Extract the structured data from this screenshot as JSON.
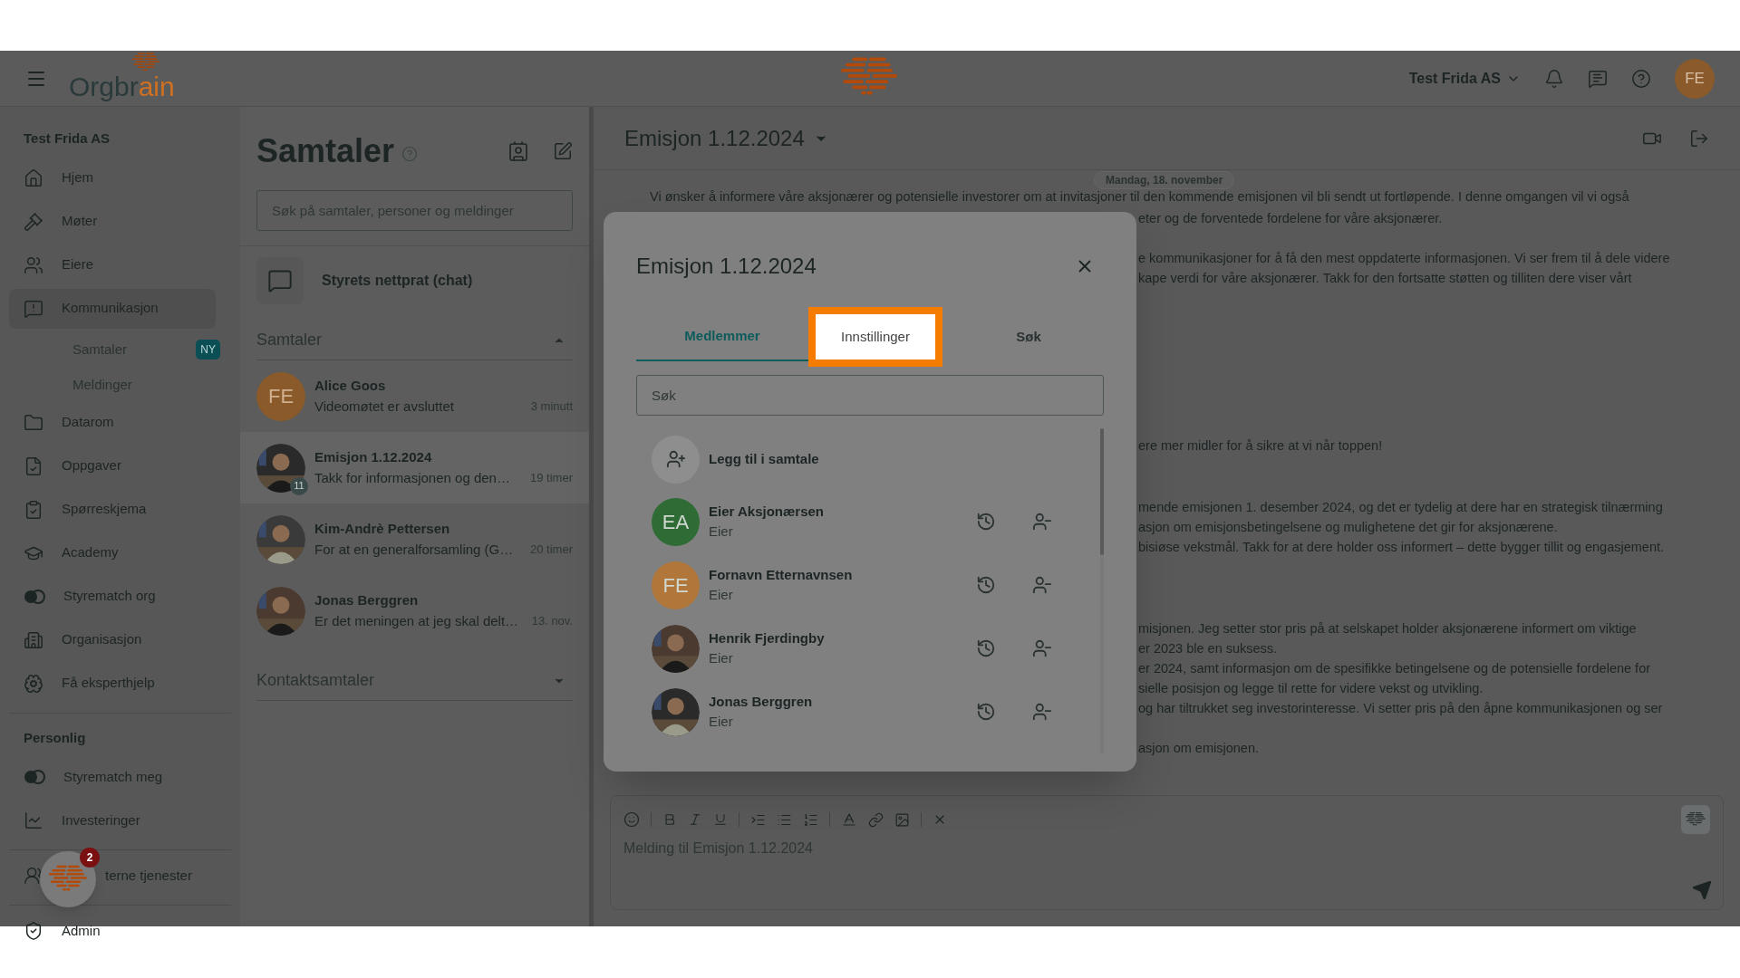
{
  "header": {
    "logo_parts": [
      "Orgbr",
      "ain"
    ],
    "company": "Test Frida AS",
    "avatar": "FE"
  },
  "sidebar": {
    "sections": [
      {
        "title": "Test Frida AS",
        "items": [
          {
            "label": "Hjem",
            "selected": false
          },
          {
            "label": "Møter",
            "selected": false
          },
          {
            "label": "Eiere",
            "selected": false
          },
          {
            "label": "Kommunikasjon",
            "selected": true,
            "children": [
              {
                "label": "Samtaler",
                "badge": "NY"
              },
              {
                "label": "Meldinger"
              }
            ]
          },
          {
            "label": "Datarom",
            "selected": false
          },
          {
            "label": "Oppgaver",
            "selected": false
          },
          {
            "label": "Spørreskjema",
            "selected": false
          },
          {
            "label": "Academy",
            "selected": false
          },
          {
            "label": "Styrematch org",
            "selected": false
          },
          {
            "label": "Organisasjon",
            "selected": false
          },
          {
            "label": "Få eksperthjelp",
            "selected": false
          }
        ]
      },
      {
        "title": "Personlig",
        "items": [
          {
            "label": "Styrematch meg",
            "selected": false
          },
          {
            "label": "Investeringer",
            "selected": false
          }
        ]
      },
      {
        "items": [
          {
            "label": "terne tjenester",
            "selected": false
          }
        ]
      },
      {
        "items": [
          {
            "label": "Admin",
            "selected": false
          }
        ]
      }
    ],
    "assistant_badge": "2"
  },
  "conversations": {
    "title": "Samtaler",
    "search_placeholder": "Søk på samtaler, personer og meldinger",
    "board_chat": "Styrets nettprat (chat)",
    "groups": [
      {
        "title": "Samtaler",
        "expanded": true,
        "items": [
          {
            "name": "Alice Goos",
            "preview": "Videomøtet er avsluttet",
            "time": "3 minutt",
            "avatar": "FE",
            "kind": "initials",
            "selected": false
          },
          {
            "name": "Emisjon 1.12.2024",
            "preview": "Takk for informasjonen og den…",
            "time": "19 timer",
            "kind": "picture",
            "count": "11",
            "selected": true
          },
          {
            "name": "Kim-Andrè Pettersen",
            "preview": "For at en generalforsamling (G…",
            "time": "20 timer",
            "kind": "picture",
            "selected": false
          },
          {
            "name": "Jonas Berggren",
            "preview": "Er det meningen at jeg skal delt…",
            "time": "13. nov.",
            "kind": "picture",
            "selected": false
          }
        ]
      },
      {
        "title": "Kontaktsamtaler",
        "expanded": false
      }
    ]
  },
  "chat": {
    "title": "Emisjon 1.12.2024",
    "date": "Mandag, 18. november",
    "first_line": "Vi ønsker å informere våre aksjonærer og potensielle investorer om at invitasjoner til den kommende emisjonen vil bli sendt ut fortløpende. I denne omgangen vil vi også",
    "paragraphs": [
      [
        "eter og de forventede fordelene for våre aksjonærer."
      ],
      [
        "e kommunikasjoner for å få den mest oppdaterte informasjonen. Vi ser frem til å dele videre",
        "kape verdi for våre aksjonærer. Takk for den fortsatte støtten og tilliten dere viser vårt"
      ],
      [
        "ere mer midler for å sikre at vi når toppen!"
      ],
      [
        "mende emisjonen 1. desember 2024, og det er tydelig at dere har en strategisk tilnærming",
        "asjon om emisjonsbetingelsene og mulighetene det gir for aksjonærene.",
        "bisiøse vekstmål. Takk for at dere holder oss informert – dette bygger tillit og engasjement."
      ],
      [
        "misjonen. Jeg setter stor pris på at selskapet holder aksjonærene informert om viktige",
        "er 2023 ble en suksess.",
        "er 2024, samt informasjon om de spesifikke betingelsene og de potensielle fordelene for",
        "sielle posisjon og legge til rette for videre vekst og utvikling.",
        "og har tiltrukket seg investorinteresse. Vi setter pris på den åpne kommunikasjonen og ser"
      ],
      [
        "asjon om emisjonen."
      ]
    ],
    "composer_placeholder": "Melding til Emisjon 1.12.2024"
  },
  "dialog": {
    "title": "Emisjon 1.12.2024",
    "tabs": [
      {
        "label": "Medlemmer",
        "selected": true,
        "highlighted": false
      },
      {
        "label": "Innstillinger",
        "selected": false,
        "highlighted": true
      },
      {
        "label": "Søk",
        "selected": false,
        "highlighted": false
      }
    ],
    "search_placeholder": "Søk",
    "add_label": "Legg til i samtale",
    "members": [
      {
        "name": "Eier Aksjonærsen",
        "role": "Eier",
        "kind": "initials",
        "avatar": "EA",
        "color": "#2e6b35"
      },
      {
        "name": "Fornavn Etternavnsen",
        "role": "Eier",
        "kind": "initials",
        "avatar": "FE",
        "color": "#b0763a"
      },
      {
        "name": "Henrik Fjerdingby",
        "role": "Eier",
        "kind": "picture"
      },
      {
        "name": "Jonas Berggren",
        "role": "Eier",
        "kind": "picture"
      }
    ]
  }
}
